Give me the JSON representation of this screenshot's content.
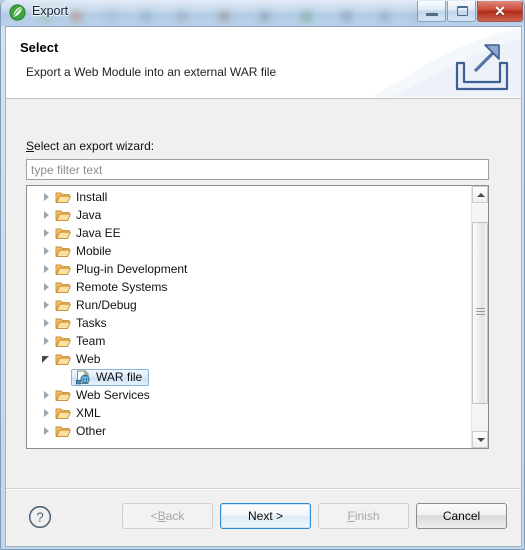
{
  "window": {
    "title": "Export",
    "app_icon": "eclipse-leaf-icon",
    "caption": {
      "minimize": "minimize-icon",
      "restore": "restore-icon",
      "close": "✕"
    }
  },
  "banner": {
    "title": "Select",
    "description": "Export a Web Module into an external WAR file",
    "icon": "export-arrow-icon"
  },
  "form": {
    "label_prefix": "S",
    "label_rest": "elect an export wizard:",
    "filter": {
      "value": "",
      "placeholder": "type filter text"
    }
  },
  "tree": {
    "items": [
      {
        "label": "Install",
        "state": "collapsed",
        "level": 0,
        "icon": "folder-icon"
      },
      {
        "label": "Java",
        "state": "collapsed",
        "level": 0,
        "icon": "folder-icon"
      },
      {
        "label": "Java EE",
        "state": "collapsed",
        "level": 0,
        "icon": "folder-icon"
      },
      {
        "label": "Mobile",
        "state": "collapsed",
        "level": 0,
        "icon": "folder-icon"
      },
      {
        "label": "Plug-in Development",
        "state": "collapsed",
        "level": 0,
        "icon": "folder-icon"
      },
      {
        "label": "Remote Systems",
        "state": "collapsed",
        "level": 0,
        "icon": "folder-icon"
      },
      {
        "label": "Run/Debug",
        "state": "collapsed",
        "level": 0,
        "icon": "folder-icon"
      },
      {
        "label": "Tasks",
        "state": "collapsed",
        "level": 0,
        "icon": "folder-icon"
      },
      {
        "label": "Team",
        "state": "collapsed",
        "level": 0,
        "icon": "folder-icon"
      },
      {
        "label": "Web",
        "state": "expanded",
        "level": 0,
        "icon": "folder-icon"
      },
      {
        "label": "WAR file",
        "state": "selected",
        "level": 1,
        "icon": "war-file-icon"
      },
      {
        "label": "Web Services",
        "state": "collapsed",
        "level": 0,
        "icon": "folder-icon"
      },
      {
        "label": "XML",
        "state": "collapsed",
        "level": 0,
        "icon": "folder-icon"
      },
      {
        "label": "Other",
        "state": "collapsed",
        "level": 0,
        "icon": "folder-icon"
      }
    ],
    "selected": "WAR file",
    "scrollbar": {
      "up": "scroll-up-arrow",
      "down": "scroll-down-arrow"
    }
  },
  "buttons": {
    "help": "?",
    "back": {
      "prefix": "< ",
      "mnemonic": "B",
      "rest": "ack",
      "enabled": false
    },
    "next": {
      "label": "Next >",
      "enabled": true,
      "default": true
    },
    "finish": {
      "mnemonic": "F",
      "rest": "inish",
      "enabled": false
    },
    "cancel": {
      "label": "Cancel",
      "enabled": true
    }
  },
  "colors": {
    "accent": "#2a8ad4",
    "selection_border": "#8db2da",
    "folder": "#e8a33d",
    "close_button": "#c94a38",
    "banner_bg": "#ffffff",
    "dialog_bg": "#f0f0f0"
  }
}
